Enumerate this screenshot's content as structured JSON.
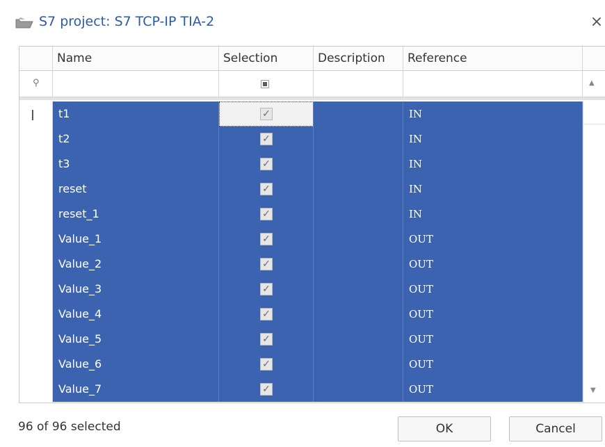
{
  "window": {
    "title": "S7 project: S7 TCP-IP TIA-2",
    "close_glyph": "×",
    "title_icon": "folder-open-icon"
  },
  "grid": {
    "columns": [
      "Name",
      "Selection",
      "Description",
      "Reference"
    ],
    "rows": [
      {
        "name": "t1",
        "selected": true,
        "description": "",
        "reference": "IN"
      },
      {
        "name": "t2",
        "selected": true,
        "description": "",
        "reference": "IN"
      },
      {
        "name": "t3",
        "selected": true,
        "description": "",
        "reference": "IN"
      },
      {
        "name": "reset",
        "selected": true,
        "description": "",
        "reference": "IN"
      },
      {
        "name": "reset_1",
        "selected": true,
        "description": "",
        "reference": "IN"
      },
      {
        "name": "Value_1",
        "selected": true,
        "description": "",
        "reference": "OUT"
      },
      {
        "name": "Value_2",
        "selected": true,
        "description": "",
        "reference": "OUT"
      },
      {
        "name": "Value_3",
        "selected": true,
        "description": "",
        "reference": "OUT"
      },
      {
        "name": "Value_4",
        "selected": true,
        "description": "",
        "reference": "OUT"
      },
      {
        "name": "Value_5",
        "selected": true,
        "description": "",
        "reference": "OUT"
      },
      {
        "name": "Value_6",
        "selected": true,
        "description": "",
        "reference": "OUT"
      },
      {
        "name": "Value_7",
        "selected": true,
        "description": "",
        "reference": "OUT"
      }
    ],
    "check_glyph": "✓",
    "pin_glyph": "⚲",
    "ibeam_glyph": "I",
    "scroll_up_glyph": "▲",
    "scroll_down_glyph": "▼",
    "selection_color": "#3c63b0"
  },
  "footer": {
    "status": "96 of 96 selected",
    "ok_label": "OK",
    "cancel_label": "Cancel"
  }
}
